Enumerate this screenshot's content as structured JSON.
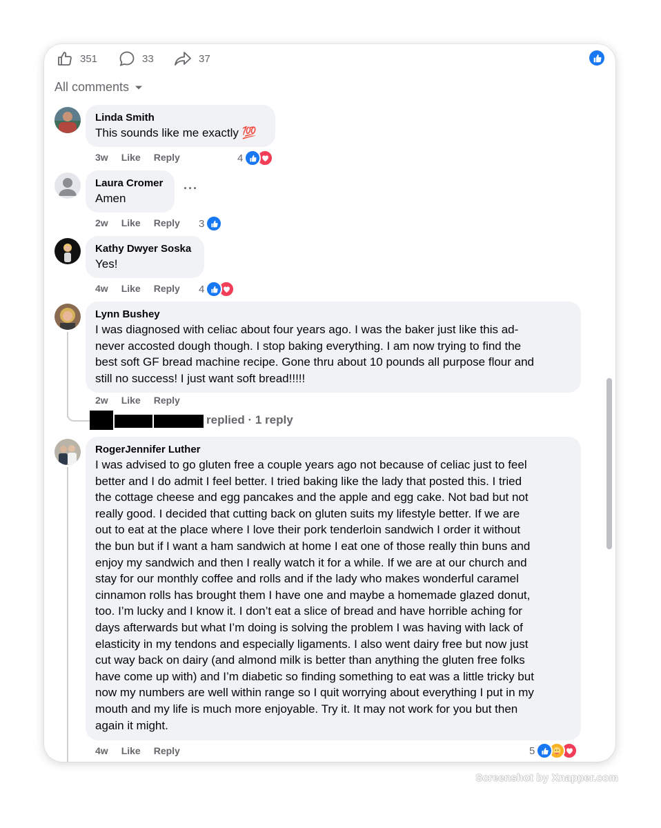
{
  "toolbar": {
    "like_count": "351",
    "comment_count": "33",
    "share_count": "37"
  },
  "comments_filter": {
    "label": "All comments"
  },
  "comments": [
    {
      "author": "Linda Smith",
      "text": "This sounds like me exactly 💯",
      "time": "3w",
      "like_label": "Like",
      "reply_label": "Reply",
      "reaction_count": "4",
      "reactions": [
        "like",
        "love"
      ]
    },
    {
      "author": "Laura Cromer",
      "text": "Amen",
      "time": "2w",
      "like_label": "Like",
      "reply_label": "Reply",
      "reaction_count": "3",
      "reactions": [
        "like"
      ]
    },
    {
      "author": "Kathy Dwyer Soska",
      "text": "Yes!",
      "time": "4w",
      "like_label": "Like",
      "reply_label": "Reply",
      "reaction_count": "4",
      "reactions": [
        "like",
        "love"
      ]
    },
    {
      "author": "Lynn Bushey",
      "text": "I was diagnosed with celiac about four years ago. I was the baker just like this ad-\nnever accosted dough though. I stop baking everything. I am now trying to find the\nbest soft GF bread machine recipe. Gone thru about 10 pounds all purpose flour and\nstill no success! I just want soft bread!!!!!",
      "time": "2w",
      "like_label": "Like",
      "reply_label": "Reply",
      "replies_label": "replied · 1 reply"
    },
    {
      "author": "RogerJennifer Luther",
      "text": "I was advised to go gluten free a couple years ago not because of celiac just to feel\nbetter and I do admit I feel better. I tried baking like the lady that posted this. I tried\nthe cottage cheese and egg pancakes and the apple and egg cake. Not bad but not\nreally good. I decided that cutting back on gluten suits my lifestyle better. If we are\nout to eat at the place where I love their pork tenderloin sandwich I order it without\nthe bun but if I want a ham sandwich at home I eat one of those really thin buns and\nenjoy my sandwich and then I really watch it for a while. If we are at our church and\nstay for our monthly coffee and rolls and if the lady who makes wonderful caramel\ncinnamon rolls has brought them I have one and maybe a homemade glazed donut,\ntoo. I’m lucky and I know it. I don’t eat a slice of bread and have horrible aching for\ndays afterwards but what I’m doing is solving the problem I was having with lack of\nelasticity in my tendons and especially ligaments. I also went dairy free but now just\ncut way back on dairy (and almond milk is better than anything the gluten free folks\nhave come up with) and I’m diabetic so finding something to eat was a little tricky but\nnow my numbers are well within range so I quit worrying about everything I put in my\nmouth and my life is much more enjoyable. Try it. It may not work for you but then\nagain it might.",
      "time": "4w",
      "like_label": "Like",
      "reply_label": "Reply",
      "reaction_count": "5",
      "reactions": [
        "like",
        "care",
        "love"
      ]
    }
  ],
  "watermark": "Screenshot by Xnapper.com",
  "colors": {
    "like_blue": "#1877f2",
    "love_red": "#f33e58",
    "care_yellow": "#f7b125",
    "bubble_bg": "#f0f2f5",
    "secondary_text": "#65676b"
  }
}
